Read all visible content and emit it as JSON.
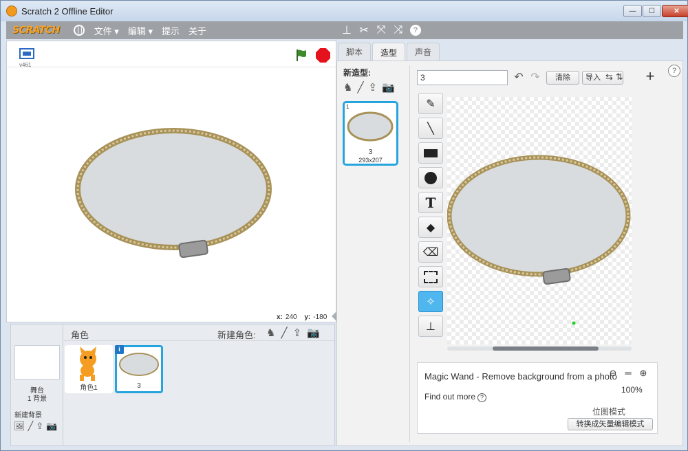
{
  "window": {
    "title": "Scratch 2 Offline Editor",
    "controls": {
      "min": "—",
      "max": "☐",
      "close": "✕"
    }
  },
  "menubar": {
    "logo": "SCRATCH",
    "items": [
      "文件 ▾",
      "编辑 ▾",
      "提示",
      "关于"
    ]
  },
  "stage": {
    "version": "v461",
    "coords": {
      "x_label": "x:",
      "x_value": "240",
      "y_label": "y:",
      "y_value": "-180"
    }
  },
  "sprites": {
    "stage_label": "舞台",
    "backdrop_count": "1 背景",
    "new_backdrop_label": "新建背景",
    "panel_title": "角色",
    "new_sprite_label": "新建角色:",
    "items": [
      {
        "name": "角色1"
      },
      {
        "name": "3"
      }
    ]
  },
  "tabs": [
    "脚本",
    "造型",
    "声音"
  ],
  "costumes": {
    "new_costume_label": "新造型:",
    "items": [
      {
        "number": "1",
        "name": "3",
        "size": "293x207"
      }
    ]
  },
  "editor": {
    "costume_name": "3",
    "clear_label": "清除",
    "import_label": "导入",
    "tip_text": "Magic Wand - Remove background from a photo",
    "find_out_more": "Find out more",
    "zoom_percent": "100%",
    "bitmap_mode_label": "位图模式",
    "convert_label": "转换成矢量编辑模式"
  },
  "colors": {
    "accent": "#25a4dd",
    "menubar": "#9da1a6",
    "stop": "#e3121d",
    "flag": "#3f8a2a"
  },
  "icons": {
    "tools": [
      "brush-icon",
      "line-icon",
      "rectangle-icon",
      "ellipse-icon",
      "text-icon",
      "fill-icon",
      "eraser-icon",
      "select-icon",
      "magic-wand-icon",
      "stamp-icon"
    ]
  }
}
